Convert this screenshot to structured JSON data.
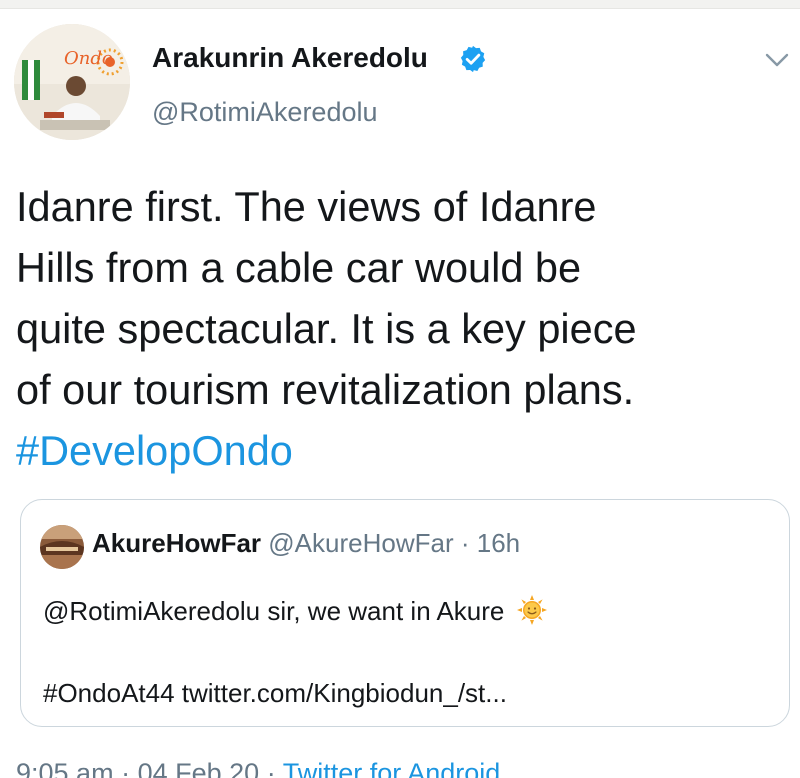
{
  "tweet": {
    "author": {
      "name": "Arakunrin Akeredolu",
      "handle": "@RotimiAkeredolu",
      "avatar_badge_text": "Ondo",
      "verified": true
    },
    "text_lines": [
      "Idanre first. The views of Idanre",
      "Hills from a cable car would be",
      "quite spectacular. It is a key piece",
      "of our tourism revitalization plans."
    ],
    "hashtag": "#DevelopOndo",
    "quoted_tweet": {
      "author_name": "AkureHowFar",
      "author_handle": "@AkureHowFar",
      "separator": "·",
      "time": "16h",
      "text_line1": "@RotimiAkeredolu sir, we want in Akure",
      "text_line2": "#OndoAt44 twitter.com/Kingbiodun_/st..."
    },
    "meta": {
      "time": "9:05 am",
      "separator1": "·",
      "date": "04 Feb 20",
      "separator2": "·",
      "source": "Twitter for Android"
    }
  },
  "colors": {
    "text_primary": "#14171a",
    "text_secondary": "#657786",
    "link": "#1b95e0",
    "verified": "#1da1f2",
    "border": "#ccd6dd"
  },
  "icons": {
    "verified": "verified-badge-icon",
    "menu": "chevron-down-icon",
    "emoji": "sun-emoji-icon"
  }
}
